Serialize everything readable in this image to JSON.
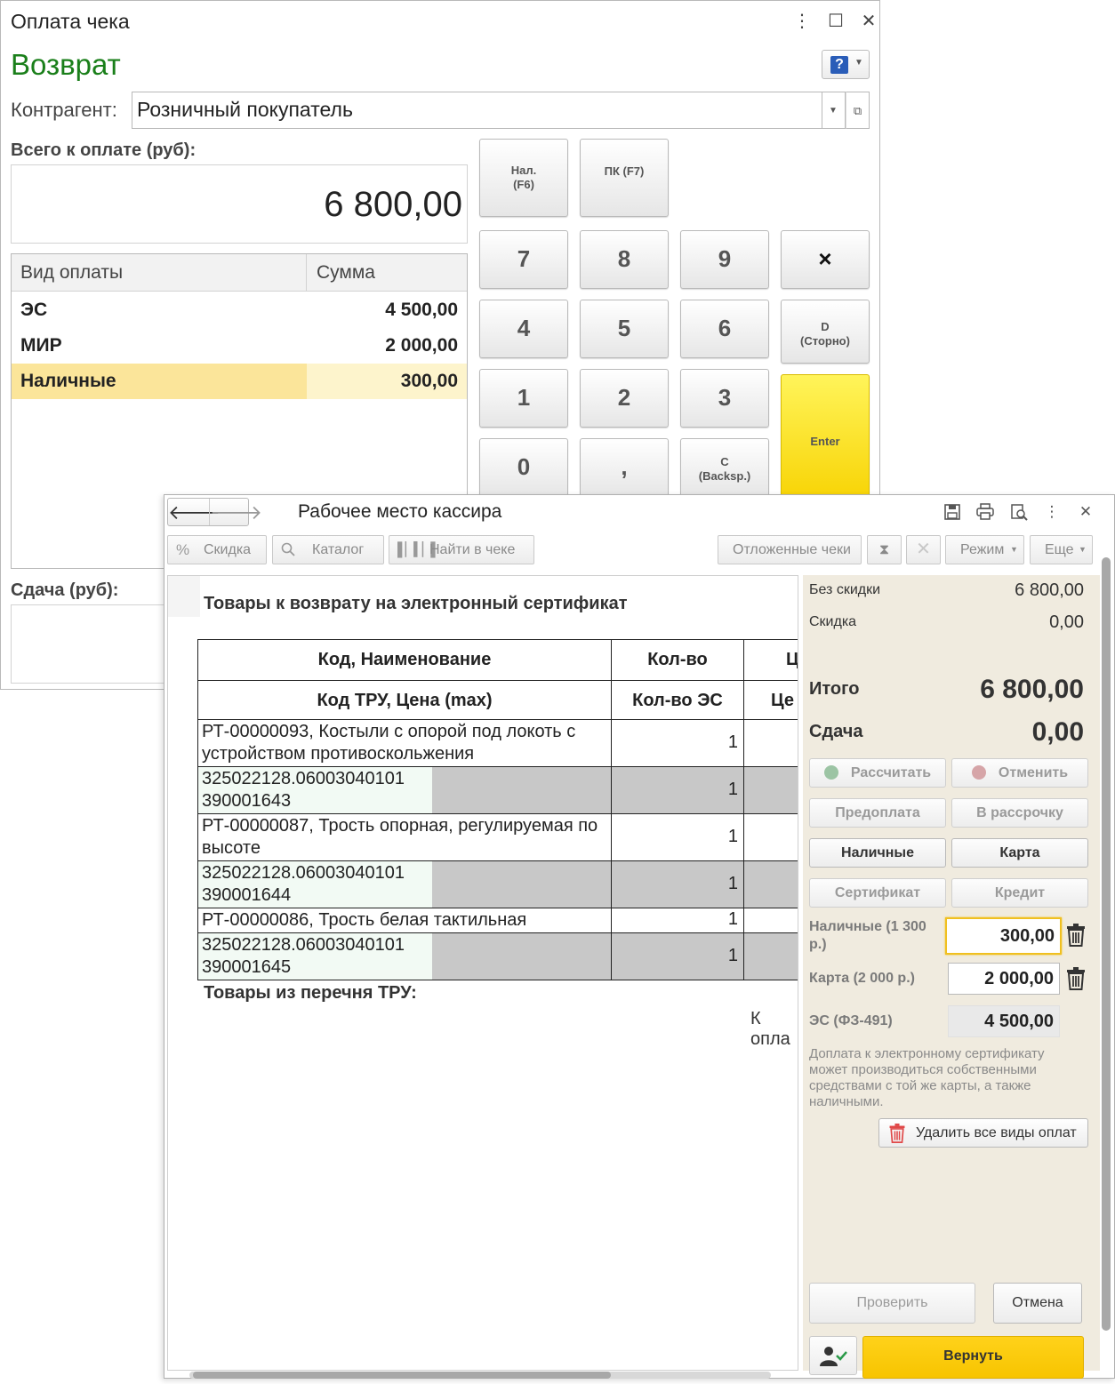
{
  "payment_window": {
    "title": "Оплата чека",
    "mode": "Возврат",
    "counterparty_label": "Контрагент:",
    "counterparty_value": "Розничный покупатель",
    "total_label": "Всего к оплате (руб):",
    "total_value": "6 800,00",
    "table": {
      "columns": [
        "Вид оплаты",
        "Сумма"
      ],
      "rows": [
        {
          "type": "ЭС",
          "amount": "4 500,00"
        },
        {
          "type": "МИР",
          "amount": "2 000,00"
        },
        {
          "type": "Наличные",
          "amount": "300,00"
        }
      ]
    },
    "change_label": "Сдача (руб):",
    "keys": {
      "cash": "Нал.\n(F6)",
      "card": "ПК (F7)",
      "k7": "7",
      "k8": "8",
      "k9": "9",
      "mul": "×",
      "k4": "4",
      "k5": "5",
      "k6": "6",
      "storno": "D\n(Сторно)",
      "k1": "1",
      "k2": "2",
      "k3": "3",
      "enter": "Enter",
      "k0": "0",
      "comma": ",",
      "backsp": "C\n(Backsp.)"
    }
  },
  "cashier_window": {
    "title": "Рабочее место кассира",
    "toolbar": {
      "discount": "Скидка",
      "catalog": "Каталог",
      "find": "Найти в чеке",
      "deferred": "Отложенные чеки",
      "mode": "Режим",
      "more": "Еще"
    },
    "document": {
      "heading": "Товары к возврату на электронный сертификат",
      "header_row1": [
        "Код, Наименование",
        "Кол-во",
        "Ц"
      ],
      "header_row2": [
        "Код ТРУ, Цена (max)",
        "Кол-во ЭС",
        "Це"
      ],
      "items": [
        {
          "name": "РТ-00000093, Костыли с опорой под локоть с устройством противоскольжения",
          "qty": "1",
          "code": "325022128.06003040101 390001643",
          "qty_es": "1"
        },
        {
          "name": "РТ-00000087, Трость опорная, регулируемая по высоте",
          "qty": "1",
          "code": "325022128.06003040101 390001644",
          "qty_es": "1"
        },
        {
          "name": "РТ-00000086, Трость белая тактильная",
          "qty": "1",
          "code": "325022128.06003040101 390001645",
          "qty_es": "1"
        }
      ],
      "heading2": "Товары из перечня ТРУ:",
      "to_pay_partial": "К опла"
    },
    "panel": {
      "no_discount_label": "Без скидки",
      "no_discount_value": "6 800,00",
      "discount_label": "Скидка",
      "discount_value": "0,00",
      "total_label": "Итого",
      "total_value": "6 800,00",
      "change_label": "Сдача",
      "change_value": "0,00",
      "btn_calc": "Рассчитать",
      "btn_cancel": "Отменить",
      "btn_prepay": "Предоплата",
      "btn_installment": "В рассрочку",
      "btn_cash": "Наличные",
      "btn_card": "Карта",
      "btn_cert": "Сертификат",
      "btn_credit": "Кредит",
      "cash_label": "Наличные (1 300 р.)",
      "cash_value": "300,00",
      "card_label": "Карта (2 000 р.)",
      "card_value": "2 000,00",
      "es_label": "ЭС (ФЗ-491)",
      "es_value": "4 500,00",
      "note": "Доплата к электронному сертификату может производиться собственными средствами с той же карты, а также наличными.",
      "delete_all": "Удалить все виды оплат",
      "check": "Проверить",
      "cancel": "Отмена",
      "return": "Вернуть"
    }
  },
  "colors": {
    "mode_green": "#1a7f1a",
    "selected_row": "#fbe59a",
    "enter_key": "#f7d200",
    "panel_bg": "#f0ebdf",
    "return_button": "#f7c400"
  },
  "icons": [
    "help-icon",
    "more-vert-icon",
    "maximize-icon",
    "close-icon",
    "arrow-left-icon",
    "arrow-right-icon",
    "save-icon",
    "print-icon",
    "preview-icon",
    "percent-icon",
    "search-icon",
    "barcode-icon",
    "hourglass-icon",
    "cross-icon",
    "trash-icon",
    "user-check-icon"
  ]
}
